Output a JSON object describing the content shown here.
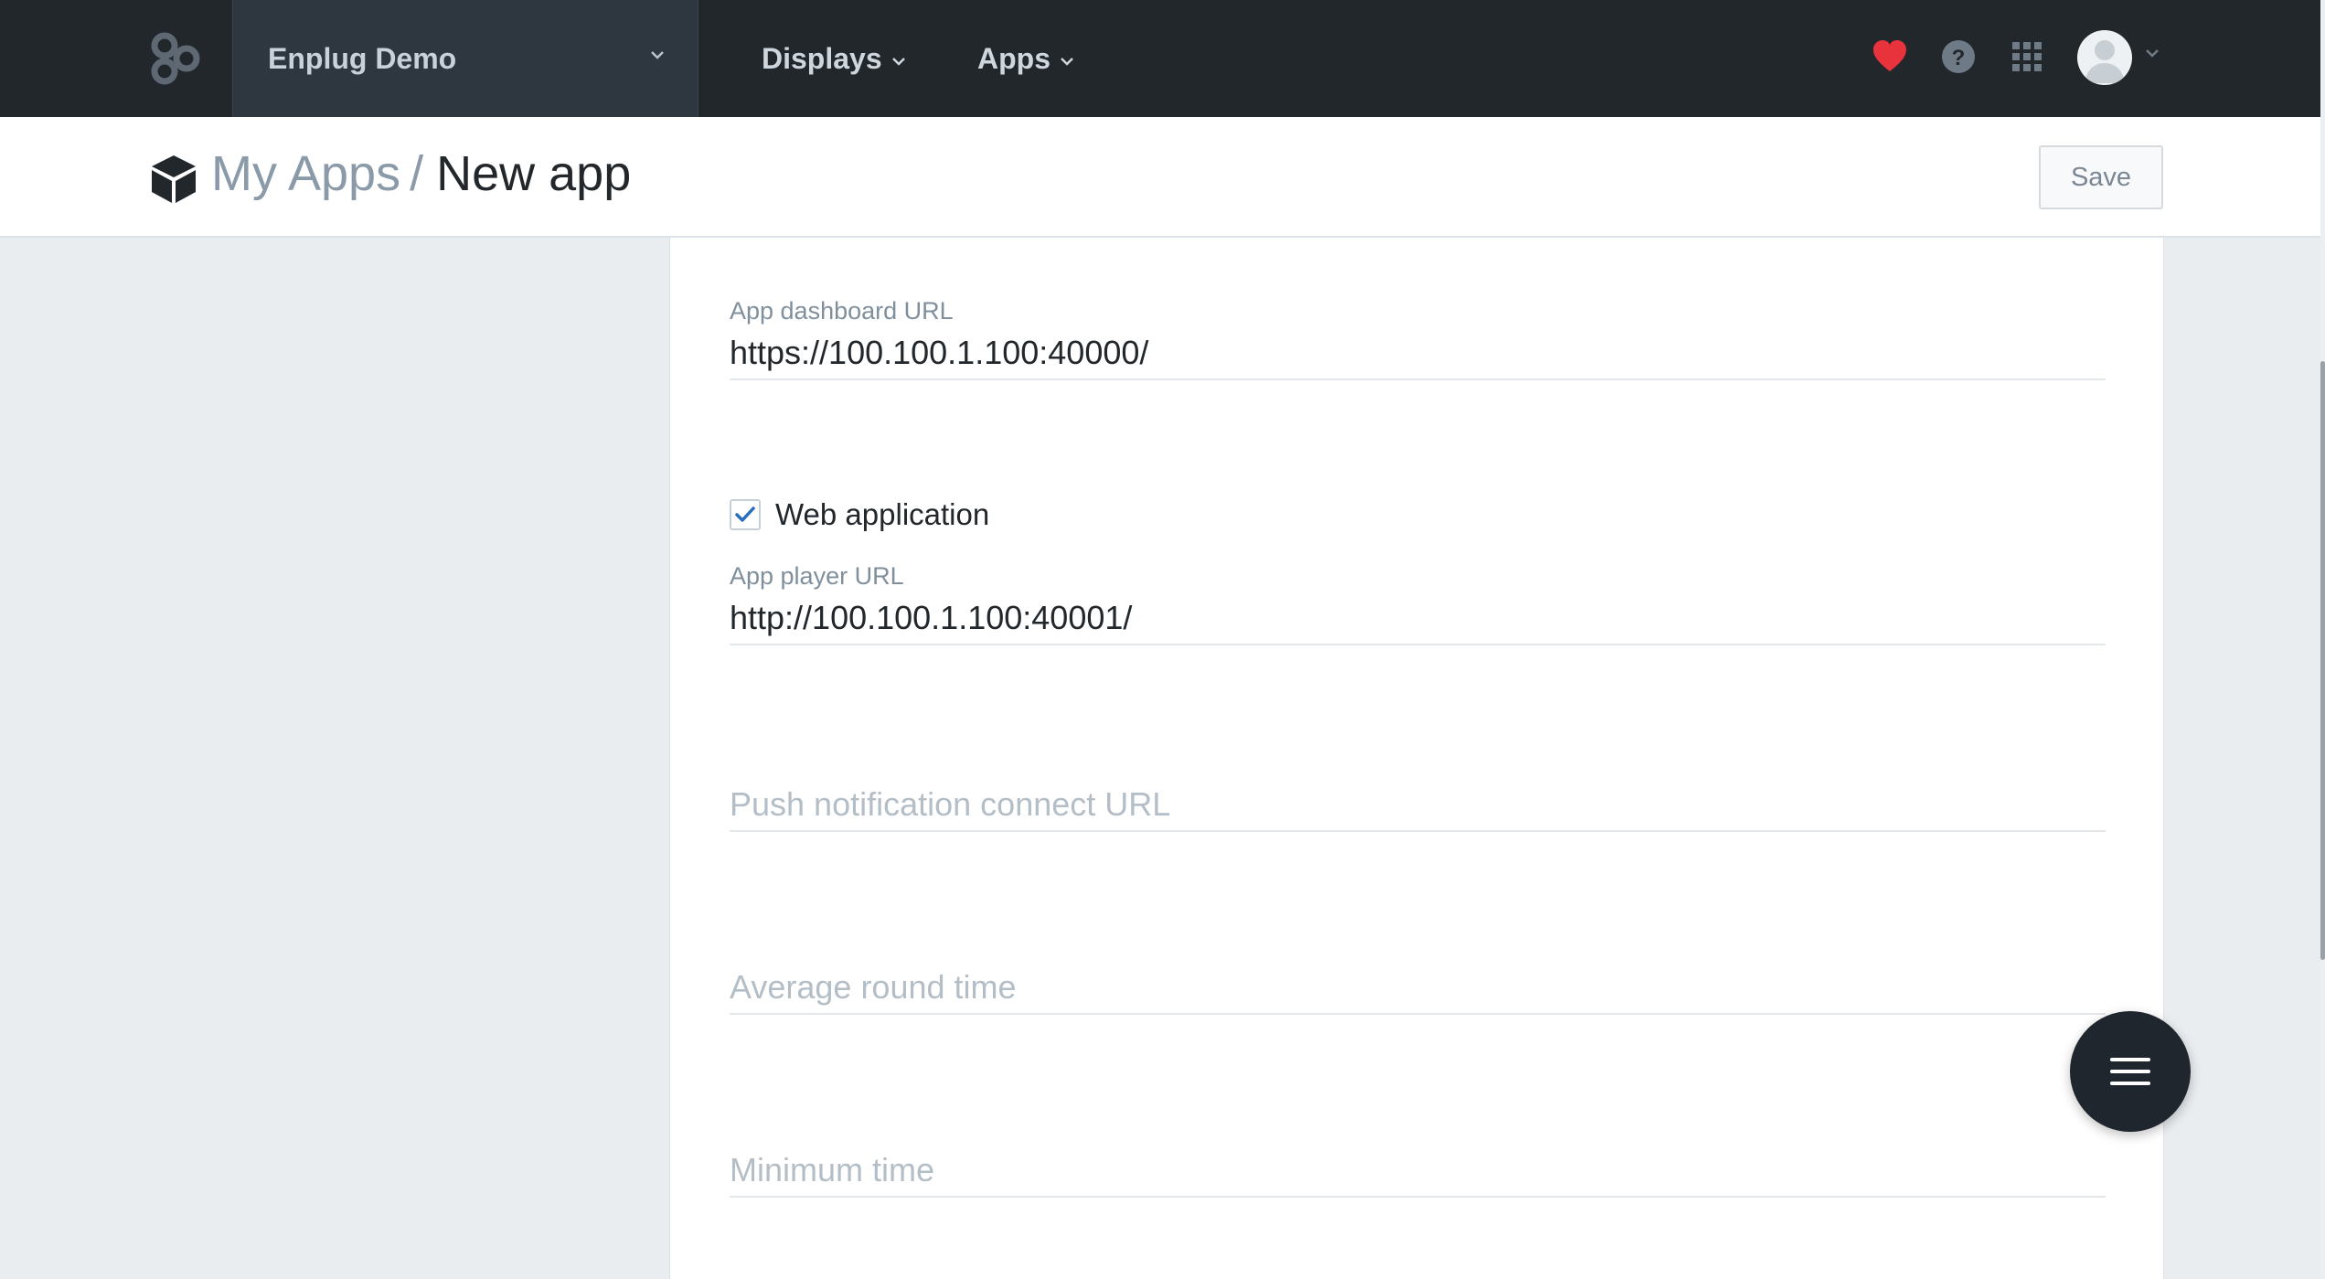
{
  "navbar": {
    "org_name": "Enplug Demo",
    "menu": {
      "displays": "Displays",
      "apps": "Apps"
    },
    "icons": [
      "enplug-logo-icon",
      "heart-icon",
      "help-icon",
      "apps-grid-icon",
      "avatar",
      "chevron-down-icon"
    ]
  },
  "header": {
    "breadcrumb_parent": "My Apps",
    "breadcrumb_separator": "/",
    "breadcrumb_current": "New app",
    "save_label": "Save"
  },
  "form": {
    "dashboard_url": {
      "label": "App dashboard URL",
      "value": "https://100.100.1.100:40000/"
    },
    "web_application": {
      "label": "Web application",
      "checked": true
    },
    "player_url": {
      "label": "App player URL",
      "value": "http://100.100.1.100:40001/"
    },
    "push_url": {
      "placeholder": "Push notification connect URL"
    },
    "avg_round_time": {
      "placeholder": "Average round time"
    },
    "minimum_time": {
      "placeholder": "Minimum time"
    }
  },
  "colors": {
    "navbar_bg": "#22272c",
    "org_switch_bg": "#2e3740",
    "heart": "#e8323c",
    "checkbox_check": "#2a6ebf",
    "page_bg": "#e9edf0",
    "fab_bg": "#1f262d"
  }
}
